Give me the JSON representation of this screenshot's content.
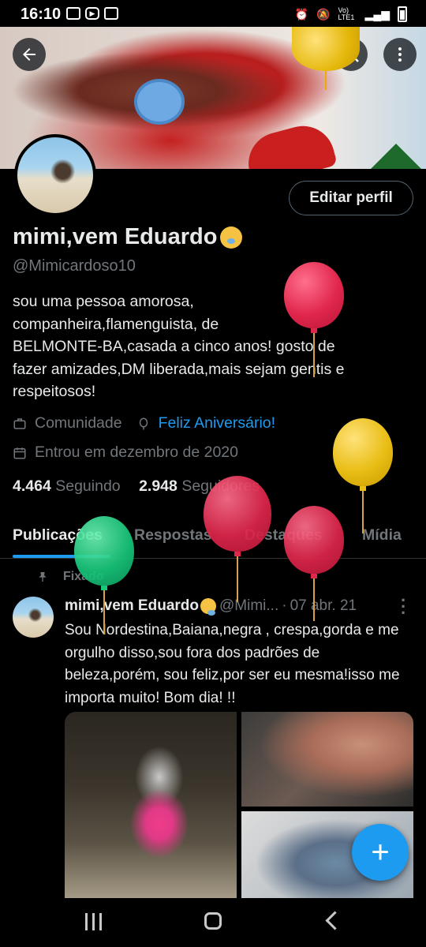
{
  "status_bar": {
    "time": "16:10",
    "network": "Vo) LTE1"
  },
  "header": {
    "back_label": "Voltar",
    "search_label": "Pesquisar",
    "more_label": "Mais"
  },
  "profile": {
    "edit_button": "Editar perfil",
    "display_name": "mimi,vem Eduardo",
    "handle": "@Mimicardoso10",
    "bio": "sou uma pessoa amorosa,\ncompanheira,flamenguista, de\nBELMONTE-BA,casada a cinco anos! gosto de\nfazer amizades,DM liberada,mais sejam gentis e\nrespeitosos!",
    "category": "Comunidade",
    "birthday_link": "Feliz Aniversário!",
    "joined": "Entrou em dezembro de 2020",
    "following_count": "4.464",
    "following_label": "Seguindo",
    "followers_count": "2.948",
    "followers_label": "Seguidores"
  },
  "tabs": [
    {
      "label": "Publicações",
      "active": true
    },
    {
      "label": "Respostas",
      "active": false
    },
    {
      "label": "Destaques",
      "active": false
    },
    {
      "label": "Mídia",
      "active": false
    }
  ],
  "post": {
    "pinned_label": "Fixado",
    "author_name": "mimi,vem Eduardo",
    "author_handle": "@Mimi...",
    "separator": "·",
    "date": "07 abr. 21",
    "text": "Sou Nordestina,Baiana,negra , crespa,gorda  e me orgulho disso,sou fora dos padrões de beleza,porém, sou feliz,por ser eu mesma!isso me importa muito! Bom dia! !!"
  },
  "fab_label": "+",
  "colors": {
    "accent": "#1d9bf0",
    "background": "#000000",
    "text": "#e7e9ea",
    "muted": "#71767b"
  }
}
